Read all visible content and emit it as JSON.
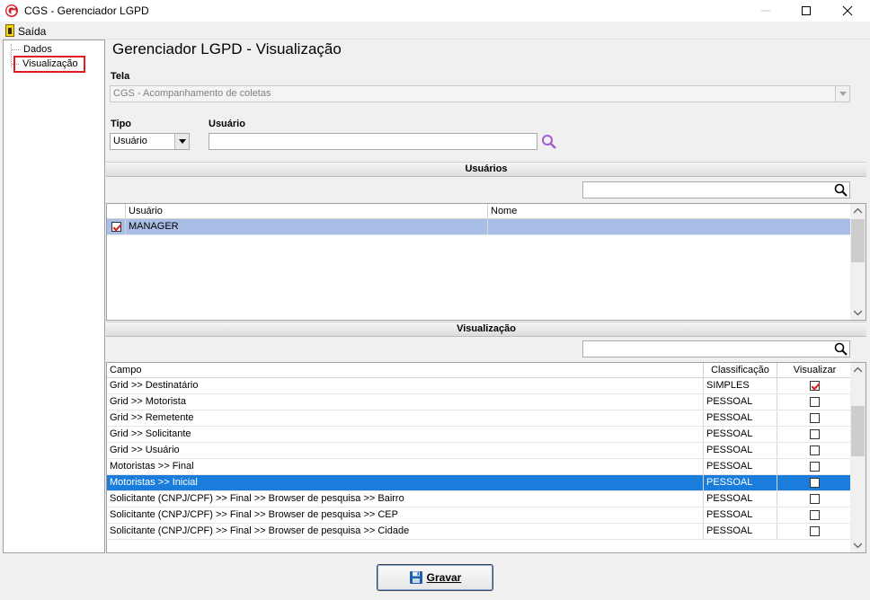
{
  "window": {
    "title": "CGS - Gerenciador LGPD",
    "minimize": "—",
    "maximize": "☐",
    "close": "✕"
  },
  "menu": {
    "exit_label": "Saída"
  },
  "tree": {
    "items": [
      {
        "label": "Dados"
      },
      {
        "label": "Visualização"
      }
    ]
  },
  "main": {
    "title": "Gerenciador LGPD - Visualização",
    "tela_label": "Tela",
    "tela_value": "CGS - Acompanhamento de coletas",
    "tipo_label": "Tipo",
    "tipo_value": "Usuário",
    "usuario_label": "Usuário",
    "usuario_value": ""
  },
  "users_section": {
    "title": "Usuários",
    "search_value": "",
    "columns": [
      "Usuário",
      "Nome"
    ],
    "rows": [
      {
        "checked": true,
        "usuario": "MANAGER",
        "nome": ""
      }
    ]
  },
  "view_section": {
    "title": "Visualização",
    "search_value": "",
    "columns": [
      "Campo",
      "Classificação",
      "Visualizar"
    ],
    "rows": [
      {
        "campo": "Grid >> Destinatário",
        "classificacao": "SIMPLES",
        "visualizar": true
      },
      {
        "campo": "Grid >> Motorista",
        "classificacao": "PESSOAL",
        "visualizar": false
      },
      {
        "campo": "Grid >> Remetente",
        "classificacao": "PESSOAL",
        "visualizar": false
      },
      {
        "campo": "Grid >> Solicitante",
        "classificacao": "PESSOAL",
        "visualizar": false
      },
      {
        "campo": "Grid >> Usuário",
        "classificacao": "PESSOAL",
        "visualizar": false
      },
      {
        "campo": "Motoristas >> Final",
        "classificacao": "PESSOAL",
        "visualizar": false
      },
      {
        "campo": "Motoristas >> Inicial",
        "classificacao": "PESSOAL",
        "visualizar": false,
        "selected": true
      },
      {
        "campo": "Solicitante (CNPJ/CPF) >> Final >> Browser de pesquisa >> Bairro",
        "classificacao": "PESSOAL",
        "visualizar": false
      },
      {
        "campo": "Solicitante (CNPJ/CPF) >> Final >> Browser de pesquisa >> CEP",
        "classificacao": "PESSOAL",
        "visualizar": false
      },
      {
        "campo": "Solicitante (CNPJ/CPF) >> Final >> Browser de pesquisa >> Cidade",
        "classificacao": "PESSOAL",
        "visualizar": false
      }
    ]
  },
  "footer": {
    "save_label": "Gravar"
  }
}
